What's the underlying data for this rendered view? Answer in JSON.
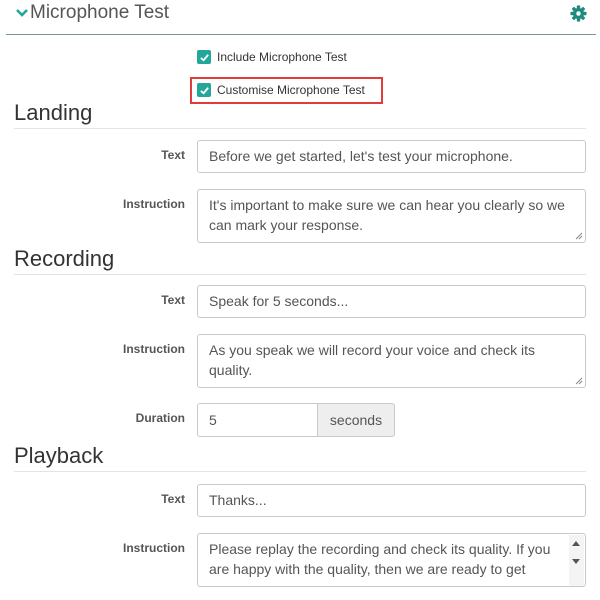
{
  "header": {
    "title": "Microphone Test",
    "chevron_icon": "chevron-down-icon",
    "gear_icon": "gear-icon"
  },
  "colors": {
    "accent": "#22a79a",
    "highlight": "#e23b3b",
    "header_rule": "#6f9a8d"
  },
  "options": {
    "include": {
      "label": "Include Microphone Test",
      "checked": true
    },
    "customise": {
      "label": "Customise Microphone Test",
      "checked": true
    }
  },
  "landing": {
    "title": "Landing",
    "text_label": "Text",
    "text_value": "Before we get started, let's test your microphone.",
    "instruction_label": "Instruction",
    "instruction_value": "It's important to make sure we can hear you clearly so we can mark your response."
  },
  "recording": {
    "title": "Recording",
    "text_label": "Text",
    "text_value": "Speak for 5 seconds...",
    "instruction_label": "Instruction",
    "instruction_value": "As you speak we will record your voice and check its quality.",
    "duration_label": "Duration",
    "duration_value": "5",
    "duration_unit": "seconds"
  },
  "playback": {
    "title": "Playback",
    "text_label": "Text",
    "text_value": "Thanks...",
    "instruction_label": "Instruction",
    "instruction_value": "Please replay the recording and check its quality. If you are happy with the quality, then we are ready to get"
  }
}
